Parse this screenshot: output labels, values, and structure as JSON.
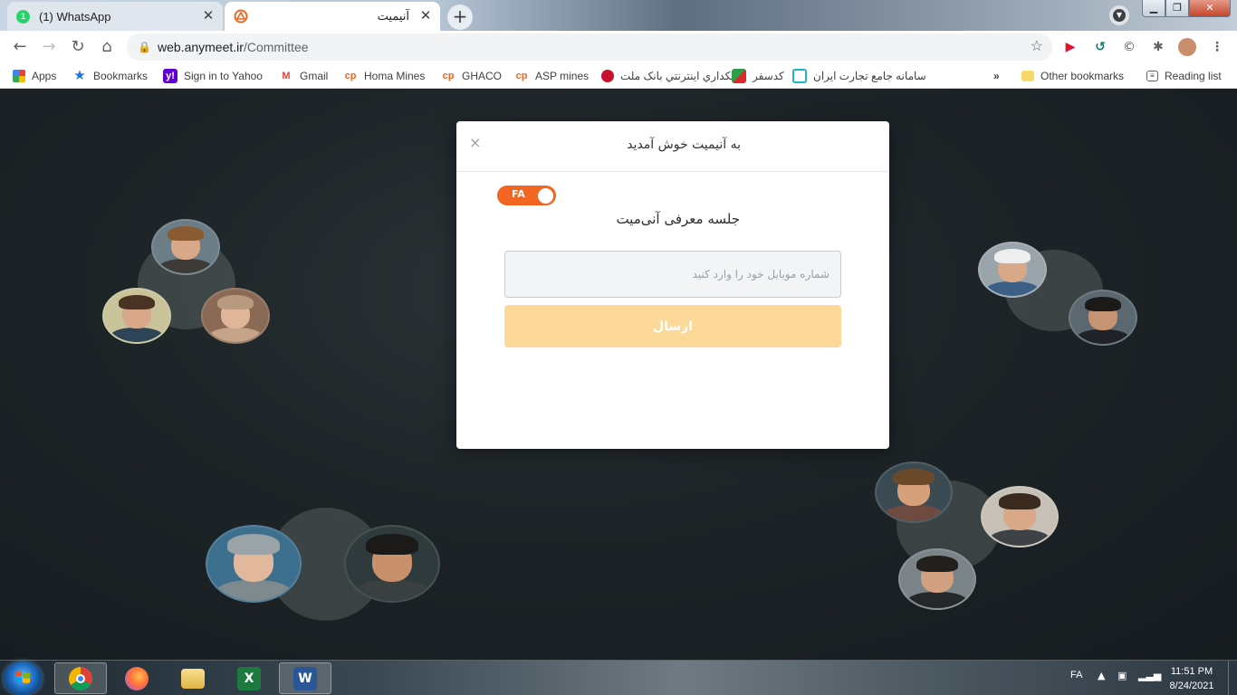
{
  "browser": {
    "tabs": [
      {
        "title": "(1) WhatsApp",
        "badge": "1"
      },
      {
        "title": "آنیمیت"
      }
    ],
    "new_tab_symbol": "+",
    "url_host": "web.anymeet.ir",
    "url_path": "/Committee",
    "bookmarks": [
      {
        "label": "Apps",
        "icon": "apps-grid-icon"
      },
      {
        "label": "Bookmarks",
        "icon": "star-icon"
      },
      {
        "label": "Sign in to Yahoo",
        "icon": "yahoo-icon"
      },
      {
        "label": "Gmail",
        "icon": "gmail-icon"
      },
      {
        "label": "Homa Mines",
        "icon": "cp-icon"
      },
      {
        "label": "GHACO",
        "icon": "cp-icon"
      },
      {
        "label": "ASP mines",
        "icon": "cp-icon"
      },
      {
        "label": "بانکداري اينترنتي بانک ملت",
        "icon": "mellat-icon"
      },
      {
        "label": "کدسفر",
        "icon": "kadsafar-icon"
      },
      {
        "label": "سامانه جامع تجارت ایران",
        "icon": "ntsw-icon"
      }
    ],
    "bookmarks_more": "»",
    "other_bookmarks": "Other bookmarks",
    "reading_list": "Reading list"
  },
  "modal": {
    "title": "به آنیمیت خوش آمدید",
    "close_symbol": "×",
    "lang_toggle": "FA",
    "session_title": "جلسه معرفی آنی‌میت",
    "phone_placeholder": "شماره موبایل خود را وارد کنید",
    "submit_label": "ارسال"
  },
  "taskbar": {
    "language": "FA",
    "time": "11:51 PM",
    "date": "8/24/2021"
  },
  "colors": {
    "accent_orange": "#f26522",
    "submit_disabled": "#fcd998",
    "whatsapp_green": "#25d366"
  }
}
